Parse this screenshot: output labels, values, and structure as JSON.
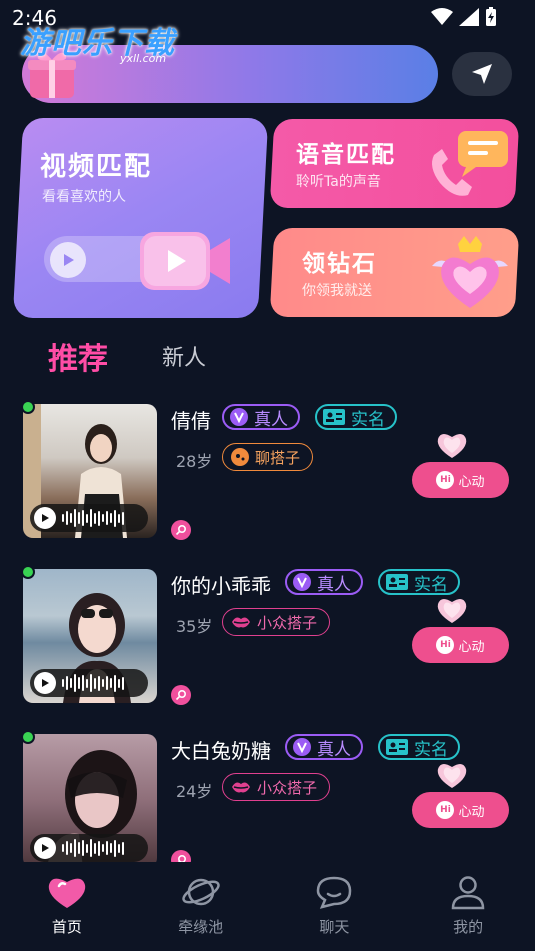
{
  "status": {
    "time": "2:46"
  },
  "watermark": {
    "main": "游吧乐下载",
    "sub": "yxll.com"
  },
  "cards": {
    "video": {
      "title": "视频匹配",
      "subtitle": "看看喜欢的人"
    },
    "voice": {
      "title": "语音匹配",
      "subtitle": "聆听Ta的声音"
    },
    "diamond": {
      "title": "领钻石",
      "subtitle": "你领我就送"
    }
  },
  "tabs": {
    "recommend": "推荐",
    "new": "新人"
  },
  "users": [
    {
      "name": "倩倩",
      "badge_real": "真人",
      "badge_verified": "实名",
      "age": "28岁",
      "tag": "聊搭子",
      "action": "心动"
    },
    {
      "name": "你的小乖乖",
      "badge_real": "真人",
      "badge_verified": "实名",
      "age": "35岁",
      "tag": "小众搭子",
      "action": "心动"
    },
    {
      "name": "大白兔奶糖",
      "badge_real": "真人",
      "badge_verified": "实名",
      "age": "24岁",
      "tag": "小众搭子",
      "action": "心动"
    }
  ],
  "nav": {
    "home": "首页",
    "fate": "牵缘池",
    "chat": "聊天",
    "mine": "我的"
  },
  "colors": {
    "accent_pink": "#ff4da6",
    "real_badge": "#9b5cf5",
    "verified_badge": "#27c2c9",
    "online": "#39d353"
  }
}
